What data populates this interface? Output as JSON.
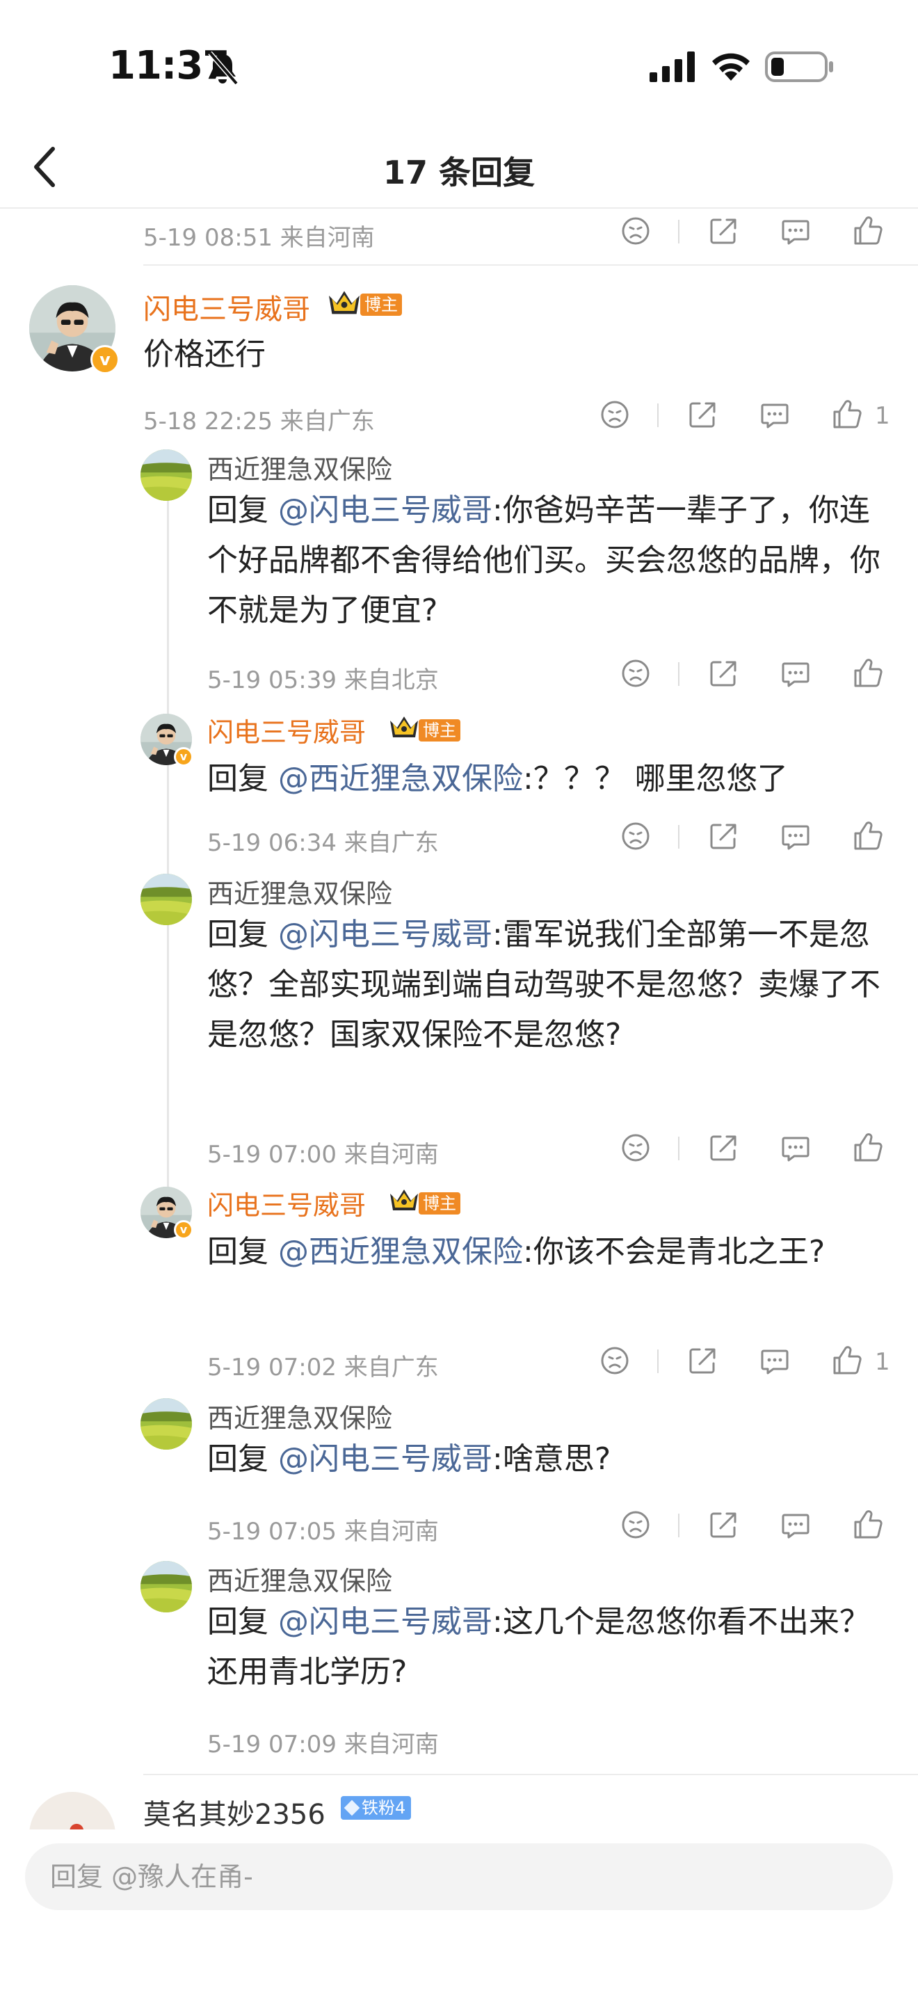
{
  "status_bar": {
    "time": "11:37"
  },
  "nav": {
    "title": "17 条回复"
  },
  "top_meta": {
    "date": "5-19 08:51",
    "location": "来自河南"
  },
  "main_comment": {
    "author": "闪电三号威哥",
    "badge": "博主",
    "text": "价格还行",
    "date": "5-18 22:25",
    "location": "来自广东",
    "like_count": "1"
  },
  "replies": [
    {
      "author": "西近狸急双保险",
      "prefix": "回复 ",
      "mention": "@闪电三号威哥",
      "text": ":你爸妈辛苦一辈子了，你连个好品牌都不舍得给他们买。买会忽悠的品牌，你不就是为了便宜?",
      "date": "5-19 05:39",
      "location": "来自北京"
    },
    {
      "author": "闪电三号威哥",
      "badge": "博主",
      "prefix": "回复 ",
      "mention": "@西近狸急双保险",
      "text": ":？？？ 哪里忽悠了",
      "date": "5-19 06:34",
      "location": "来自广东"
    },
    {
      "author": "西近狸急双保险",
      "prefix": "回复 ",
      "mention": "@闪电三号威哥",
      "text": ":雷军说我们全部第一不是忽悠？全部实现端到端自动驾驶不是忽悠？卖爆了不是忽悠？国家双保险不是忽悠?",
      "date": "5-19 07:00",
      "location": "来自河南"
    },
    {
      "author": "闪电三号威哥",
      "badge": "博主",
      "prefix": "回复 ",
      "mention": "@西近狸急双保险",
      "text": ":你该不会是青北之王?",
      "date": "5-19 07:02",
      "location": "来自广东",
      "like_count": "1"
    },
    {
      "author": "西近狸急双保险",
      "prefix": "回复 ",
      "mention": "@闪电三号威哥",
      "text": ":啥意思?",
      "date": "5-19 07:05",
      "location": "来自河南"
    },
    {
      "author": "西近狸急双保险",
      "prefix": "回复 ",
      "mention": "@闪电三号威哥",
      "text": ":这几个是忽悠你看不出来？还用青北学历?",
      "date": "5-19 07:09",
      "location": "来自河南"
    }
  ],
  "next_comment": {
    "author": "莫名其妙2356",
    "fan_badge": "铁粉4"
  },
  "reply_box": {
    "placeholder": "回复 @豫人在甬-"
  },
  "colors": {
    "author_orange": "#e8721c",
    "mention_blue": "#4a6796",
    "badge_orange": "#f08a24",
    "fan_blue": "#63a4f4"
  },
  "icons": [
    "bell-slash-icon",
    "signal-icon",
    "wifi-icon",
    "battery-icon",
    "back-icon",
    "frown-icon",
    "share-icon",
    "comment-icon",
    "thumbs-up-icon",
    "crown-icon",
    "verified-icon"
  ]
}
